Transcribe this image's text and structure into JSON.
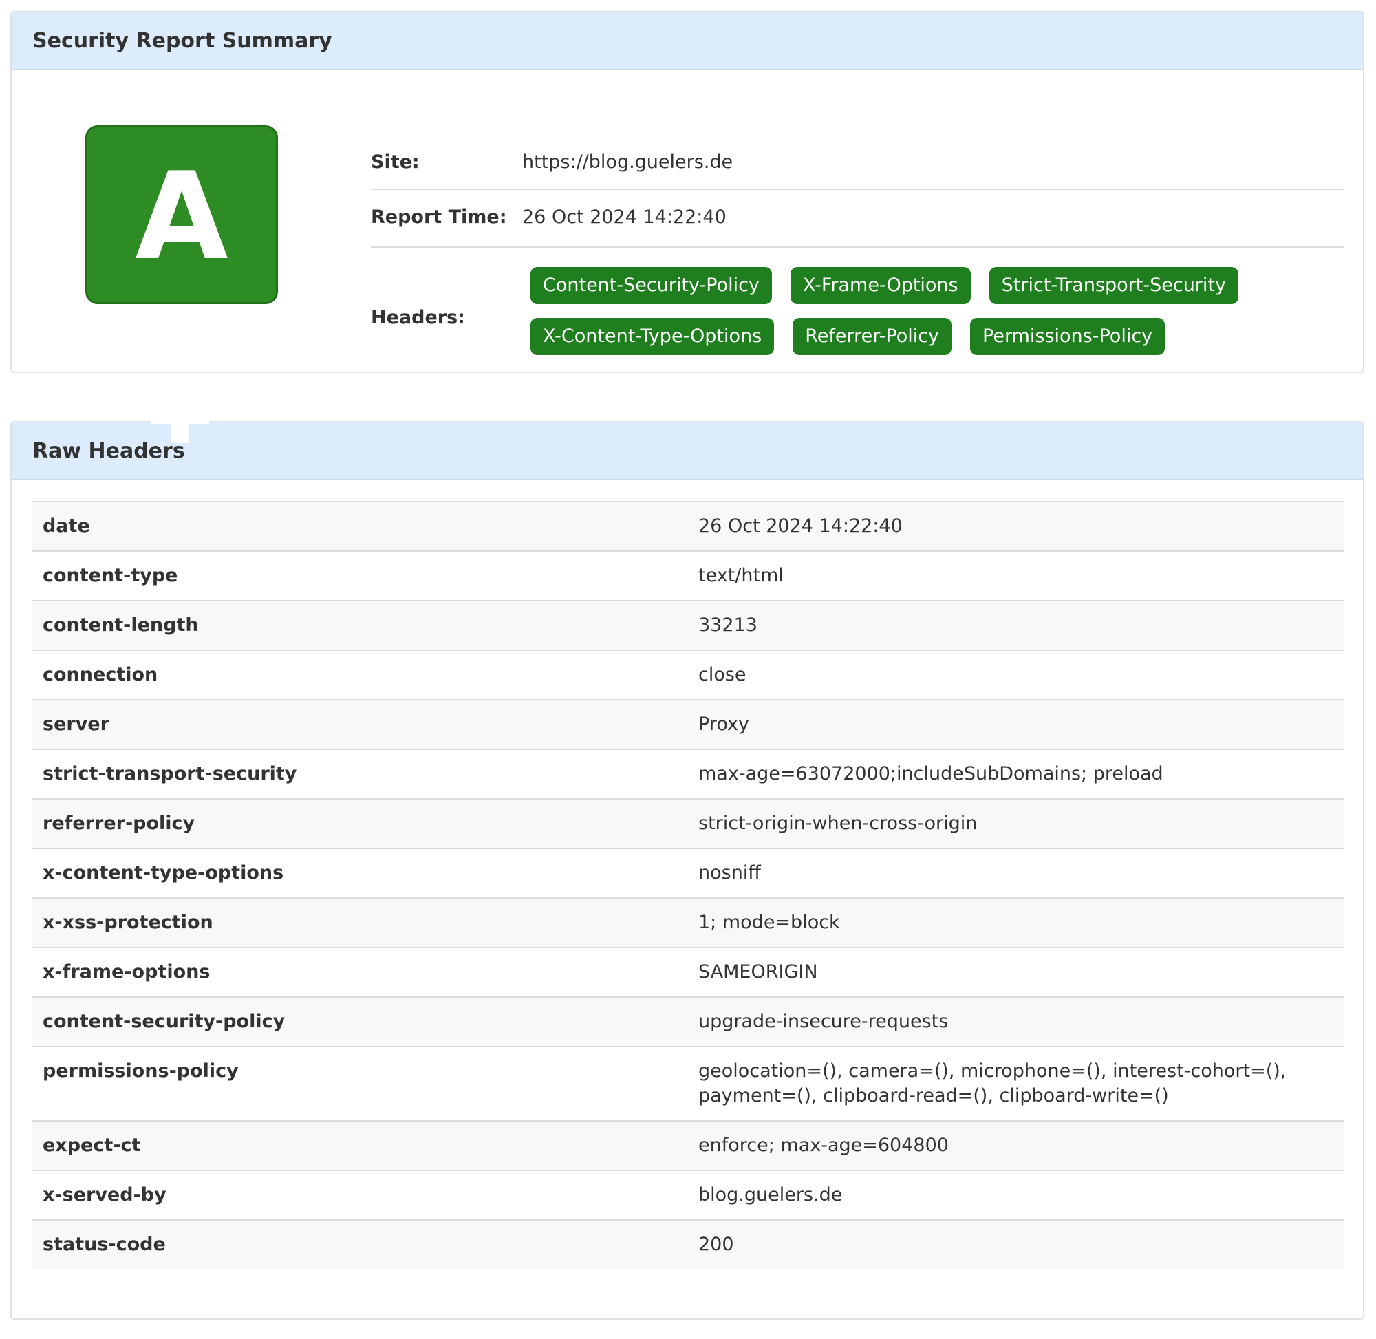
{
  "summary": {
    "title": "Security Report Summary",
    "grade": "A",
    "grade_color": "#2e8c24",
    "site_label": "Site:",
    "site_value": "https://blog.guelers.de",
    "time_label": "Report Time:",
    "time_value": "26 Oct 2024 14:22:40",
    "headers_label": "Headers:",
    "badges": [
      "Content-Security-Policy",
      "X-Frame-Options",
      "Strict-Transport-Security",
      "X-Content-Type-Options",
      "Referrer-Policy",
      "Permissions-Policy"
    ],
    "badge_color": "#1f7f1f"
  },
  "raw": {
    "title": "Raw Headers",
    "rows": [
      {
        "key": "date",
        "value": "26 Oct 2024 14:22:40"
      },
      {
        "key": "content-type",
        "value": "text/html"
      },
      {
        "key": "content-length",
        "value": "33213"
      },
      {
        "key": "connection",
        "value": "close"
      },
      {
        "key": "server",
        "value": "Proxy"
      },
      {
        "key": "strict-transport-security",
        "value": "max-age=63072000;includeSubDomains; preload"
      },
      {
        "key": "referrer-policy",
        "value": "strict-origin-when-cross-origin"
      },
      {
        "key": "x-content-type-options",
        "value": "nosniff"
      },
      {
        "key": "x-xss-protection",
        "value": "1; mode=block"
      },
      {
        "key": "x-frame-options",
        "value": "SAMEORIGIN"
      },
      {
        "key": "content-security-policy",
        "value": "upgrade-insecure-requests"
      },
      {
        "key": "permissions-policy",
        "value": "geolocation=(), camera=(), microphone=(), interest-cohort=(), payment=(), clipboard-read=(), clipboard-write=()"
      },
      {
        "key": "expect-ct",
        "value": "enforce; max-age=604800"
      },
      {
        "key": "x-served-by",
        "value": "blog.guelers.de"
      },
      {
        "key": "status-code",
        "value": "200"
      }
    ]
  }
}
